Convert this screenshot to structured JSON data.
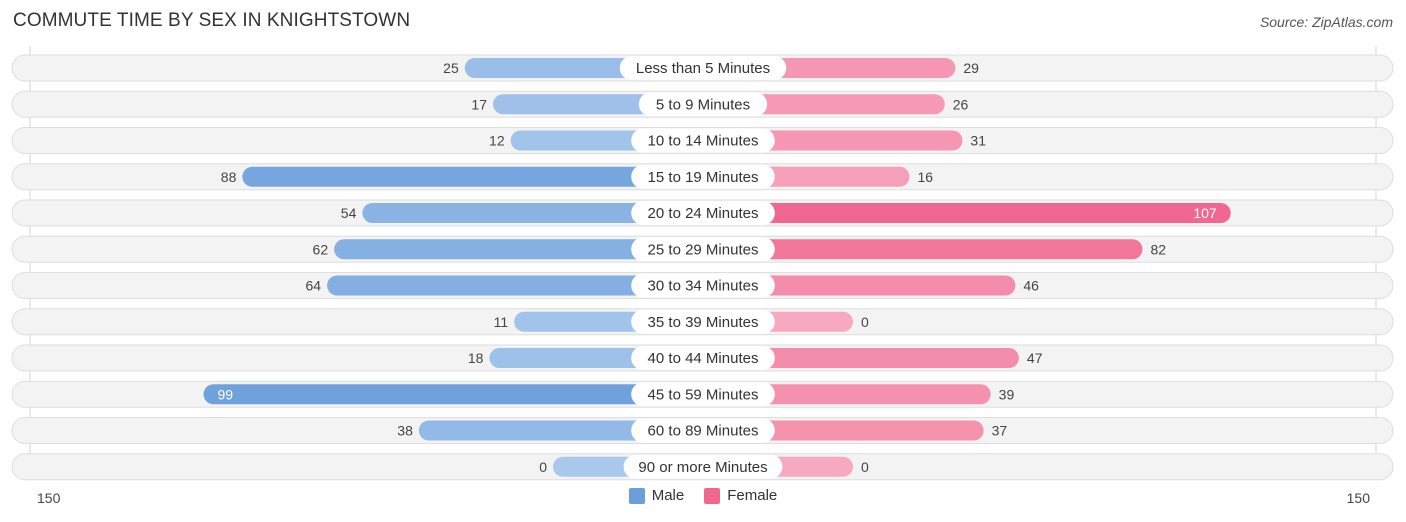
{
  "header": {
    "title": "COMMUTE TIME BY SEX IN KNIGHTSTOWN",
    "source": "Source: ZipAtlas.com"
  },
  "legend": [
    {
      "label": "Male",
      "color": "#6a9fdb"
    },
    {
      "label": "Female",
      "color": "#f06890"
    }
  ],
  "axis": {
    "left_label": "150",
    "right_label": "150"
  },
  "chart_data": {
    "type": "bar",
    "orientation": "horizontal-diverging",
    "title": "COMMUTE TIME BY SEX IN KNIGHTSTOWN",
    "xlabel": "",
    "ylabel": "",
    "xlim": [
      -150,
      150
    ],
    "categories": [
      "Less than 5 Minutes",
      "5 to 9 Minutes",
      "10 to 14 Minutes",
      "15 to 19 Minutes",
      "20 to 24 Minutes",
      "25 to 29 Minutes",
      "30 to 34 Minutes",
      "35 to 39 Minutes",
      "40 to 44 Minutes",
      "45 to 59 Minutes",
      "60 to 89 Minutes",
      "90 or more Minutes"
    ],
    "series": [
      {
        "name": "Male",
        "side": "left",
        "color": "#6a9fdb",
        "color_light": "#a9c8ec",
        "values": [
          25,
          17,
          12,
          88,
          54,
          62,
          64,
          11,
          18,
          99,
          38,
          0
        ]
      },
      {
        "name": "Female",
        "side": "right",
        "color": "#f06890",
        "color_light": "#f7a9c0",
        "values": [
          29,
          26,
          31,
          16,
          107,
          82,
          46,
          0,
          47,
          39,
          37,
          0
        ]
      }
    ],
    "tick_labels": [
      "150",
      "150"
    ],
    "legend_position": "bottom-center",
    "grid": false
  }
}
